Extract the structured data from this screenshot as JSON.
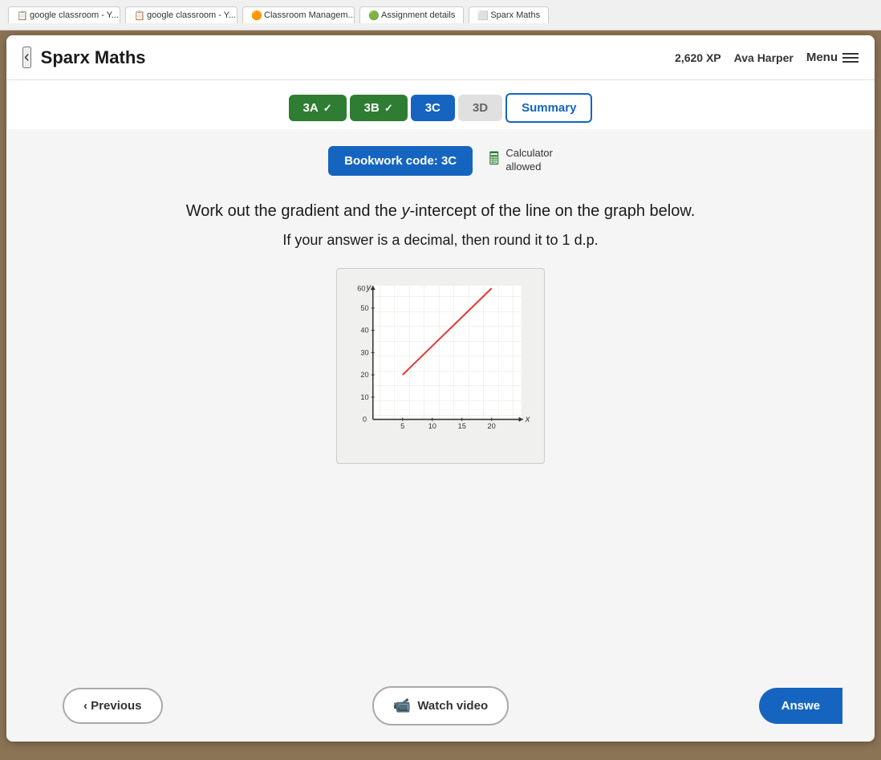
{
  "browser": {
    "tabs": [
      {
        "label": "google classroom - Y...",
        "icon": "📋",
        "active": false
      },
      {
        "label": "google classroom - Y...",
        "icon": "📋",
        "active": false
      },
      {
        "label": "Classroom Managem...",
        "icon": "🟠",
        "active": false
      },
      {
        "label": "Assignment details",
        "icon": "🟢",
        "active": false
      },
      {
        "label": "Sparx Maths",
        "icon": "⬜",
        "active": true
      }
    ]
  },
  "header": {
    "back_label": "‹",
    "title": "Sparx Maths",
    "xp": "2,620 XP",
    "user": "Ava Harper",
    "menu_label": "Menu"
  },
  "tabs": [
    {
      "label": "3A",
      "state": "completed"
    },
    {
      "label": "3B",
      "state": "completed"
    },
    {
      "label": "3C",
      "state": "active"
    },
    {
      "label": "3D",
      "state": "inactive"
    },
    {
      "label": "Summary",
      "state": "summary"
    }
  ],
  "bookwork": {
    "code_label": "Bookwork code: 3C",
    "calculator_label": "Calculator",
    "calculator_sub": "allowed"
  },
  "question": {
    "line1": "Work out the gradient and the y-intercept of the line on the graph below.",
    "line2": "If your answer is a decimal, then round it to 1 d.p."
  },
  "graph": {
    "y_label": "y",
    "x_label": "x",
    "y_values": [
      "60",
      "50",
      "40",
      "30",
      "20",
      "10"
    ],
    "x_values": [
      "0",
      "5",
      "10",
      "15",
      "20"
    ],
    "line_start": {
      "x": 5,
      "y": 20
    },
    "line_end": {
      "x": 20,
      "y": 60
    }
  },
  "buttons": {
    "previous_label": "‹ Previous",
    "watch_video_label": "Watch video",
    "answer_label": "Answe"
  }
}
